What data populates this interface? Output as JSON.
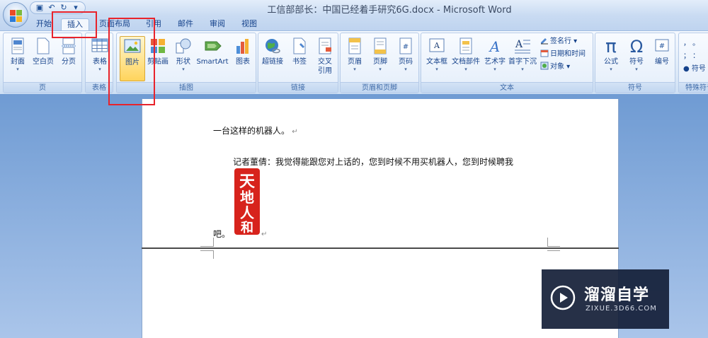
{
  "window": {
    "title": "工信部部长：中国已经着手研究6G.docx - Microsoft Word"
  },
  "qat": {
    "save_icon": "save-icon",
    "undo_icon": "undo-icon",
    "redo_icon": "redo-icon",
    "customize": "▾"
  },
  "tabs": [
    {
      "label": "开始"
    },
    {
      "label": "插入"
    },
    {
      "label": "页面布局"
    },
    {
      "label": "引用"
    },
    {
      "label": "邮件"
    },
    {
      "label": "审阅"
    },
    {
      "label": "视图"
    }
  ],
  "active_tab": "插入",
  "ribbon": {
    "groups": {
      "pages": "页",
      "tables": "表格",
      "illustrations": "插图",
      "links": "链接",
      "header_footer": "页眉和页脚",
      "text": "文本",
      "symbols": "符号",
      "special_symbols": "特殊符号"
    },
    "buttons": {
      "cover": "封面",
      "blank_page": "空白页",
      "page_break": "分页",
      "table": "表格",
      "picture": "图片",
      "clipart": "剪贴画",
      "shapes": "形状",
      "smartart": "SmartArt",
      "chart": "图表",
      "hyperlink": "超链接",
      "bookmark": "书签",
      "cross_ref_1": "交叉",
      "cross_ref_2": "引用",
      "header": "页眉",
      "footer": "页脚",
      "page_number": "页码",
      "textbox": "文本框",
      "quick_parts": "文档部件",
      "wordart": "艺术字",
      "dropcap": "首字下沉",
      "signature_line": "签名行",
      "date_time": "日期和时间",
      "object": "对象",
      "equation": "公式",
      "symbol": "符号",
      "number": "编号",
      "special_symbol": "符号",
      "special_punct_1": "，  。",
      "special_punct_2": "；  ："
    }
  },
  "document": {
    "line1": "一台这样的机器人。",
    "line2": "记者董倩：我觉得能跟您对上话的，您到时候不用买机器人，您到时候聘我",
    "line3": "吧。",
    "seal_text": "天地人和"
  },
  "watermark": {
    "title": "溜溜自学",
    "url": "ZIXUE.3D66.COM"
  },
  "colors": {
    "highlight_red": "#e8232b",
    "ribbon_blue": "#15428b"
  }
}
